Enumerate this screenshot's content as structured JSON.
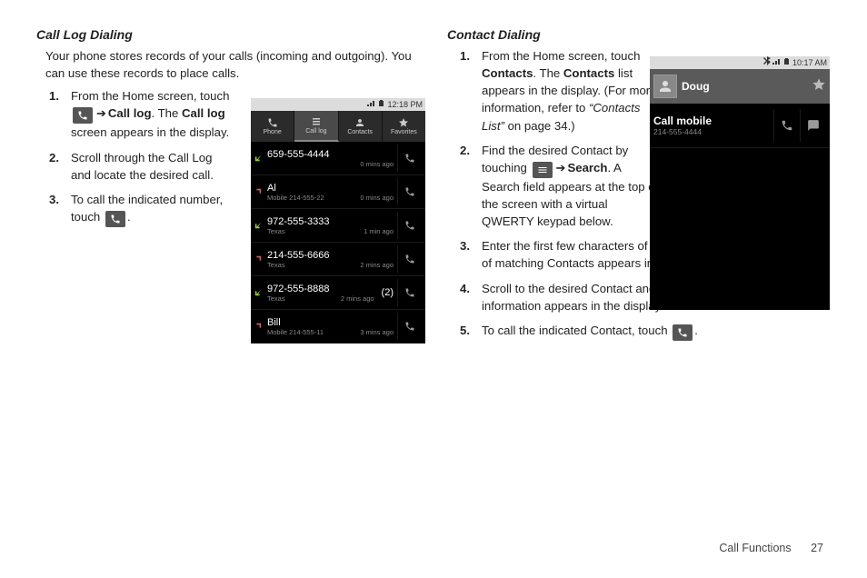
{
  "left": {
    "title": "Call Log Dialing",
    "intro": "Your phone stores records of your calls (incoming and outgoing). You can use these records to place calls.",
    "steps": {
      "s1a": "From the Home screen, touch ",
      "s1b_link": "Call log",
      "s1c": ". The ",
      "s1d_bold": "Call log",
      "s1e": " screen appears in the display.",
      "s2": "Scroll through the Call Log and locate the desired call.",
      "s3a": "To call the indicated number, touch ",
      "s3b": "."
    }
  },
  "right": {
    "title": "Contact Dialing",
    "steps": {
      "s1a": "From the Home screen, touch ",
      "s1b_bold": "Contacts",
      "s1c": ". The ",
      "s1d_bold": "Contacts",
      "s1e": " list appears in the display. (For more information, refer to ",
      "s1f_italic": "“Contacts List”",
      "s1g": "  on page 34.)",
      "s2a": "Find the desired Contact by touching ",
      "s2b_link": "Search",
      "s2c": ". A Search field appears at the top of the screen with a virtual QWERTY keypad below.",
      "s3": "Enter the first few characters of the desired Contact's name. A list of matching Contacts appears in the display.",
      "s4": "Scroll to the desired Contact and touch it. The Contact's information appears in the display.",
      "s5a": "To call the indicated Contact, touch ",
      "s5b": "."
    }
  },
  "calllog_phone": {
    "status_time": "12:18 PM",
    "tabs": {
      "phone": "Phone",
      "calllog": "Call log",
      "contacts": "Contacts",
      "favorites": "Favorites"
    },
    "rows": [
      {
        "dir": "in",
        "num": "659-555-4444",
        "loc": "",
        "time": "0 mins ago",
        "count": ""
      },
      {
        "dir": "out",
        "num": "Al",
        "loc": "Mobile 214-555-22",
        "time": "0 mins ago",
        "count": ""
      },
      {
        "dir": "in",
        "num": "972-555-3333",
        "loc": "Texas",
        "time": "1 min ago",
        "count": ""
      },
      {
        "dir": "out",
        "num": "214-555-6666",
        "loc": "Texas",
        "time": "2 mins ago",
        "count": ""
      },
      {
        "dir": "in",
        "num": "972-555-8888",
        "loc": "Texas",
        "time": "2 mins ago",
        "count": "(2)"
      },
      {
        "dir": "out",
        "num": "Bill",
        "loc": "Mobile 214-555-11",
        "time": "3 mins ago",
        "count": ""
      }
    ]
  },
  "contact_phone": {
    "status_time": "10:17 AM",
    "name": "Doug",
    "row_label": "Call mobile",
    "row_num": "214-555-4444"
  },
  "footer": {
    "label": "Call Functions",
    "page": "27"
  }
}
